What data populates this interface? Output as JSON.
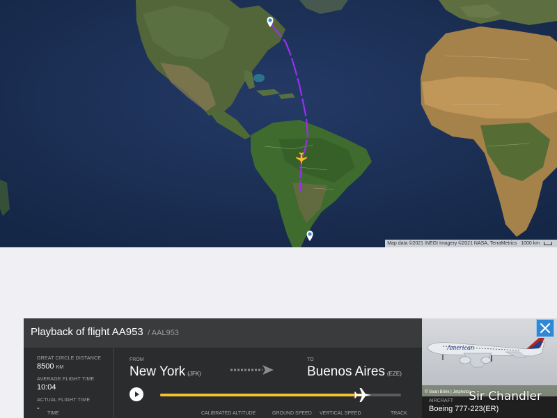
{
  "map": {
    "attribution": "Map data ©2021 INEGI Imagery ©2021 NASA, TerraMetrics",
    "scale": "1000 km"
  },
  "panel": {
    "title": "Playback of flight AA953",
    "callsign": "/ AAL953",
    "stats": {
      "distance_label": "GREAT CIRCLE DISTANCE",
      "distance_value": "8500",
      "distance_unit": "KM",
      "avg_time_label": "AVERAGE FLIGHT TIME",
      "avg_time_value": "10:04",
      "actual_time_label": "ACTUAL FLIGHT TIME",
      "actual_time_value": "-"
    },
    "route": {
      "from_label": "FROM",
      "from_city": "New York",
      "from_code": "(JFK)",
      "to_label": "TO",
      "to_city": "Buenos Aires",
      "to_code": "(EZE)"
    },
    "playback": {
      "progress_fraction": 0.84
    },
    "columns": [
      "TIME",
      "CALIBRATED ALTITUDE",
      "GROUND SPEED",
      "VERTICAL SPEED",
      "TRACK"
    ],
    "aircraft": {
      "label": "AIRCRAFT",
      "value": "Boeing 777-223(ER)",
      "photo_credit": "© Sean Brink | Jetphotos",
      "watermark": "Sir Chandler",
      "livery_text": "American"
    }
  },
  "colors": {
    "track": "#9b2ff0",
    "progress": "#f5c12e",
    "close_button": "#2f88d6",
    "panel_bg": "#2f3032"
  }
}
